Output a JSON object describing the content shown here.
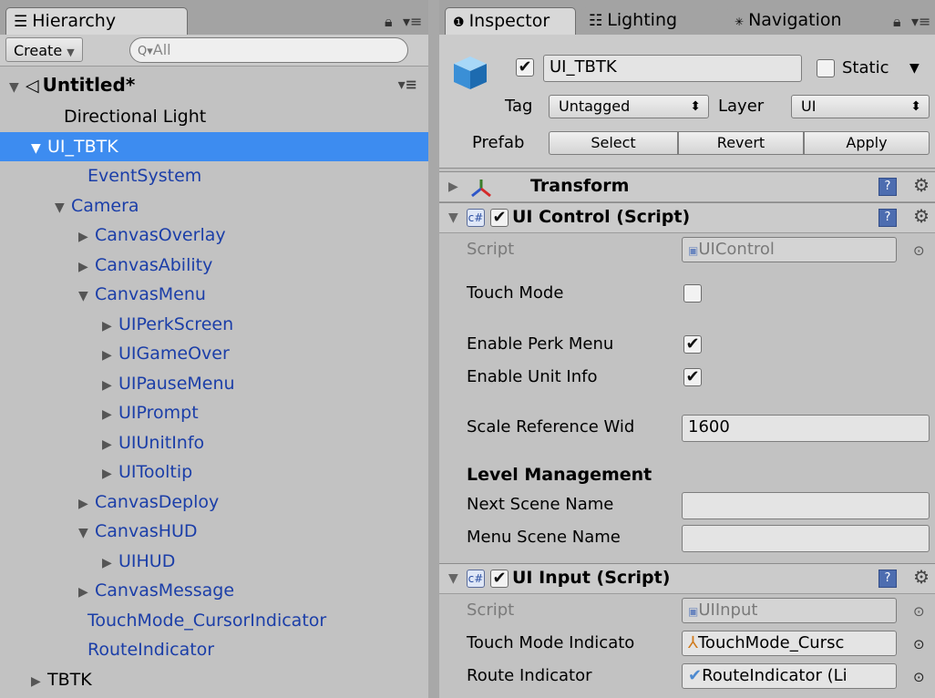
{
  "hierarchy": {
    "tab_label": "Hierarchy",
    "create_label": "Create",
    "search_placeholder": "All",
    "scene_name": "Untitled*",
    "items": [
      {
        "label": "Directional Light",
        "depth": 0,
        "expander": "",
        "prefab": false
      },
      {
        "label": "UI_TBTK",
        "depth": 0,
        "expander": "▼",
        "prefab": true,
        "selected": true
      },
      {
        "label": "EventSystem",
        "depth": 1,
        "expander": "",
        "prefab": true
      },
      {
        "label": "Camera",
        "depth": 1,
        "expander": "▼",
        "prefab": true
      },
      {
        "label": "CanvasOverlay",
        "depth": 2,
        "expander": "▶",
        "prefab": true
      },
      {
        "label": "CanvasAbility",
        "depth": 2,
        "expander": "▶",
        "prefab": true
      },
      {
        "label": "CanvasMenu",
        "depth": 2,
        "expander": "▼",
        "prefab": true
      },
      {
        "label": "UIPerkScreen",
        "depth": 3,
        "expander": "▶",
        "prefab": true
      },
      {
        "label": "UIGameOver",
        "depth": 3,
        "expander": "▶",
        "prefab": true
      },
      {
        "label": "UIPauseMenu",
        "depth": 3,
        "expander": "▶",
        "prefab": true
      },
      {
        "label": "UIPrompt",
        "depth": 3,
        "expander": "▶",
        "prefab": true
      },
      {
        "label": "UIUnitInfo",
        "depth": 3,
        "expander": "▶",
        "prefab": true
      },
      {
        "label": "UITooltip",
        "depth": 3,
        "expander": "▶",
        "prefab": true
      },
      {
        "label": "CanvasDeploy",
        "depth": 2,
        "expander": "▶",
        "prefab": true
      },
      {
        "label": "CanvasHUD",
        "depth": 2,
        "expander": "▼",
        "prefab": true
      },
      {
        "label": "UIHUD",
        "depth": 3,
        "expander": "▶",
        "prefab": true
      },
      {
        "label": "CanvasMessage",
        "depth": 2,
        "expander": "▶",
        "prefab": true
      },
      {
        "label": "TouchMode_CursorIndicator",
        "depth": 1,
        "expander": "",
        "prefab": true
      },
      {
        "label": "RouteIndicator",
        "depth": 1,
        "expander": "",
        "prefab": true
      },
      {
        "label": "TBTK",
        "depth": 0,
        "expander": "▶",
        "prefab": false
      }
    ]
  },
  "inspector": {
    "tabs": {
      "inspector": "Inspector",
      "lighting": "Lighting",
      "navigation": "Navigation"
    },
    "object_name": "UI_TBTK",
    "static_label": "Static",
    "tag_label": "Tag",
    "tag_value": "Untagged",
    "layer_label": "Layer",
    "layer_value": "UI",
    "prefab_label": "Prefab",
    "prefab_buttons": {
      "select": "Select",
      "revert": "Revert",
      "apply": "Apply"
    },
    "transform_title": "Transform",
    "ui_control": {
      "title": "UI Control (Script)",
      "script_label": "Script",
      "script_value": "UIControl",
      "touch_mode_label": "Touch Mode",
      "touch_mode_checked": false,
      "enable_perk_label": "Enable Perk Menu",
      "enable_perk_checked": true,
      "enable_unit_label": "Enable Unit Info",
      "enable_unit_checked": true,
      "scale_ref_label": "Scale Reference Wid",
      "scale_ref_value": "1600",
      "level_section": "Level Management",
      "next_scene_label": "Next Scene Name",
      "next_scene_value": "",
      "menu_scene_label": "Menu Scene Name",
      "menu_scene_value": ""
    },
    "ui_input": {
      "title": "UI Input (Script)",
      "script_label": "Script",
      "script_value": "UIInput",
      "touch_indicator_label": "Touch Mode Indicato",
      "touch_indicator_value": "TouchMode_Cursc",
      "route_indicator_label": "Route Indicator",
      "route_indicator_value": "RouteIndicator (Li"
    }
  },
  "icons": {
    "check": "✔",
    "lock": "🔒",
    "menu": "▾≡",
    "gear": "⚙",
    "help": "?",
    "target": "⊙"
  }
}
